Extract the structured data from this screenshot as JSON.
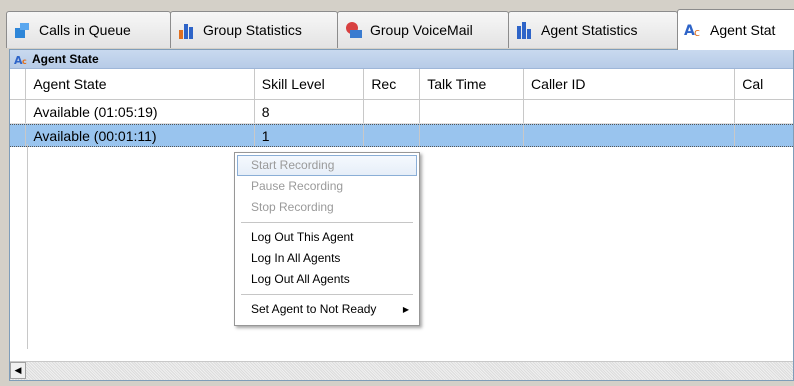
{
  "tabs": [
    {
      "label": "Calls in Queue",
      "icon": "phone-queue-icon"
    },
    {
      "label": "Group Statistics",
      "icon": "bar-chart-group-icon"
    },
    {
      "label": "Group VoiceMail",
      "icon": "voicemail-icon"
    },
    {
      "label": "Agent Statistics",
      "icon": "bar-chart-agent-icon"
    },
    {
      "label": "Agent Stat",
      "icon": "agent-state-icon"
    }
  ],
  "panel": {
    "title": "Agent State"
  },
  "grid": {
    "columns": [
      "Agent State",
      "Skill Level",
      "Rec",
      "Talk Time",
      "Caller ID",
      "Cal"
    ],
    "rows": [
      [
        "Available (01:05:19)",
        "8",
        "",
        "",
        "",
        ""
      ],
      [
        "Available (00:01:11)",
        "1",
        "",
        "",
        "",
        ""
      ]
    ]
  },
  "context_menu": {
    "items": [
      {
        "label": "Start Recording",
        "enabled": false
      },
      {
        "label": "Pause Recording",
        "enabled": false
      },
      {
        "label": "Stop Recording",
        "enabled": false
      },
      {
        "label": "Log Out This Agent",
        "enabled": true
      },
      {
        "label": "Log In All Agents",
        "enabled": true
      },
      {
        "label": "Log Out All Agents",
        "enabled": true
      },
      {
        "label": "Set Agent to Not Ready",
        "enabled": true,
        "submenu": true
      }
    ]
  },
  "colors": {
    "selection": "#99c4ee",
    "titlebar": "#c9d9ef",
    "border": "#7f9db9"
  }
}
